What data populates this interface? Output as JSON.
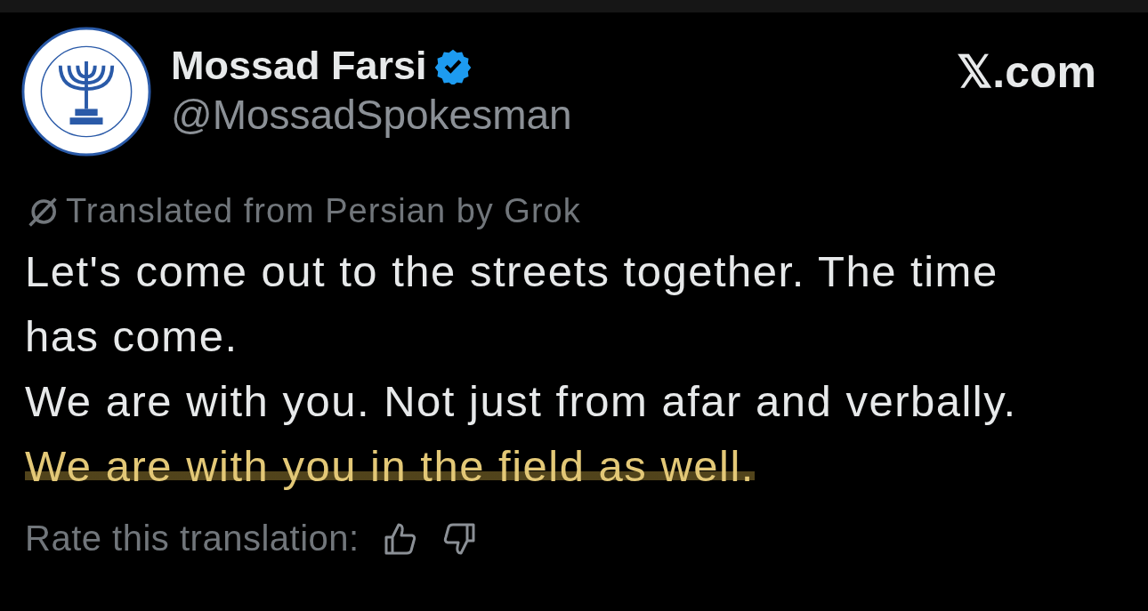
{
  "author": {
    "name": "Mossad Farsi",
    "verified": true,
    "handle": "@MossadSpokesman"
  },
  "brand": "𝕏.com",
  "translation_note": "Translated from Persian by Grok",
  "paragraphs": [
    {
      "text": "Let's come out to the streets together. The time has come.",
      "highlighted": false
    },
    {
      "text": "We are with you. Not just from afar and verbally.",
      "highlighted": false
    },
    {
      "text": "We are with you in the field as well.",
      "highlighted": true
    }
  ],
  "rating": {
    "label": "Rate this translation:"
  }
}
